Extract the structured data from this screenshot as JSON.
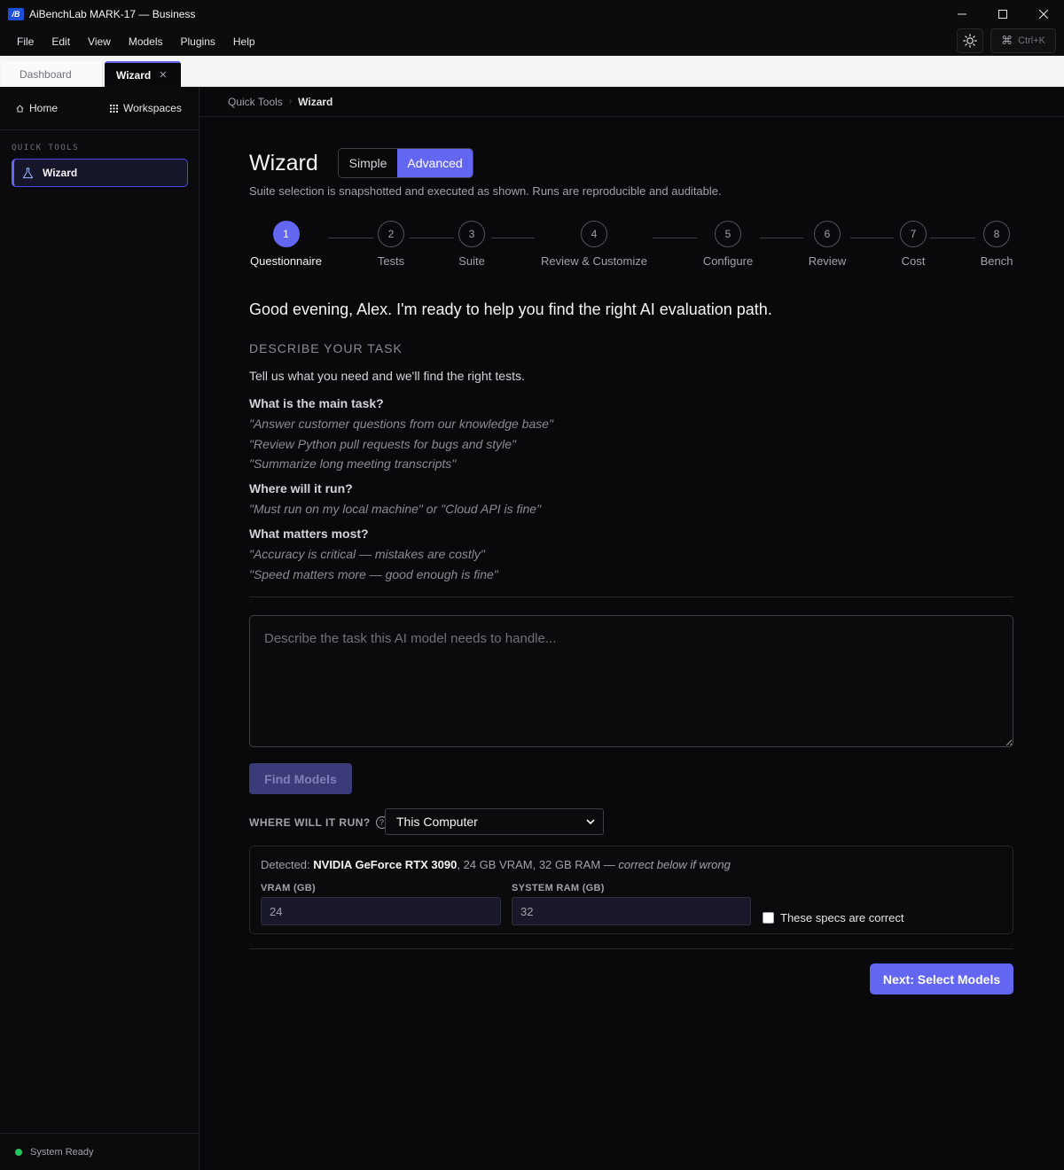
{
  "window": {
    "logo_text": "/B",
    "title": "AiBenchLab MARK-17 — Business"
  },
  "menu": [
    "File",
    "Edit",
    "View",
    "Models",
    "Plugins",
    "Help"
  ],
  "command_palette": {
    "shortcut": "Ctrl+K"
  },
  "tabs": [
    {
      "label": "Dashboard",
      "active": false
    },
    {
      "label": "Wizard",
      "active": true,
      "close": "✕"
    }
  ],
  "sidebar": {
    "home_label": "Home",
    "workspaces_label": "Workspaces",
    "section_title": "QUICK TOOLS",
    "active_item": "Wizard",
    "status": "System Ready",
    "status_color": "#22c55e"
  },
  "breadcrumb": {
    "parent": "Quick Tools",
    "current": "Wizard"
  },
  "page": {
    "title": "Wizard",
    "mode_simple": "Simple",
    "mode_advanced": "Advanced",
    "active_mode": "Advanced",
    "subtitle": "Suite selection is snapshotted and executed as shown. Runs are reproducible and auditable."
  },
  "stepper": {
    "active_step": 1,
    "steps": [
      {
        "num": "1",
        "label": "Questionnaire"
      },
      {
        "num": "2",
        "label": "Tests"
      },
      {
        "num": "3",
        "label": "Suite"
      },
      {
        "num": "4",
        "label": "Review & Customize"
      },
      {
        "num": "5",
        "label": "Configure"
      },
      {
        "num": "6",
        "label": "Review"
      },
      {
        "num": "7",
        "label": "Cost"
      },
      {
        "num": "8",
        "label": "Bench"
      }
    ]
  },
  "questionnaire": {
    "greeting": "Good evening, Alex. I'm ready to help you find the right AI evaluation path.",
    "section_label": "DESCRIBE YOUR TASK",
    "intro": "Tell us what you need and we'll find the right tests.",
    "q1": "What is the main task?",
    "q1_examples": [
      "\"Answer customer questions from our knowledge base\"",
      "\"Review Python pull requests for bugs and style\"",
      "\"Summarize long meeting transcripts\""
    ],
    "q2": "Where will it run?",
    "q2_examples": [
      "\"Must run on my local machine\" or \"Cloud API is fine\""
    ],
    "q3": "What matters most?",
    "q3_examples": [
      "\"Accuracy is critical — mistakes are costly\"",
      "\"Speed matters more — good enough is fine\""
    ],
    "task_placeholder": "Describe the task this AI model needs to handle...",
    "task_value": "",
    "find_button": "Find Models"
  },
  "run_location": {
    "label": "WHERE WILL IT RUN?",
    "selected": "This Computer"
  },
  "hardware": {
    "detected_prefix": "Detected: ",
    "gpu": "NVIDIA GeForce RTX 3090",
    "specs": ", 24 GB VRAM, 32 GB RAM — ",
    "note": "correct below if wrong",
    "vram_label": "VRAM (GB)",
    "vram_value": "24",
    "ram_label": "SYSTEM RAM (GB)",
    "ram_value": "32",
    "confirm_label": "These specs are correct",
    "confirmed": false
  },
  "next_button": "Next: Select Models",
  "colors": {
    "accent": "#6366f1",
    "background": "#09090b"
  }
}
